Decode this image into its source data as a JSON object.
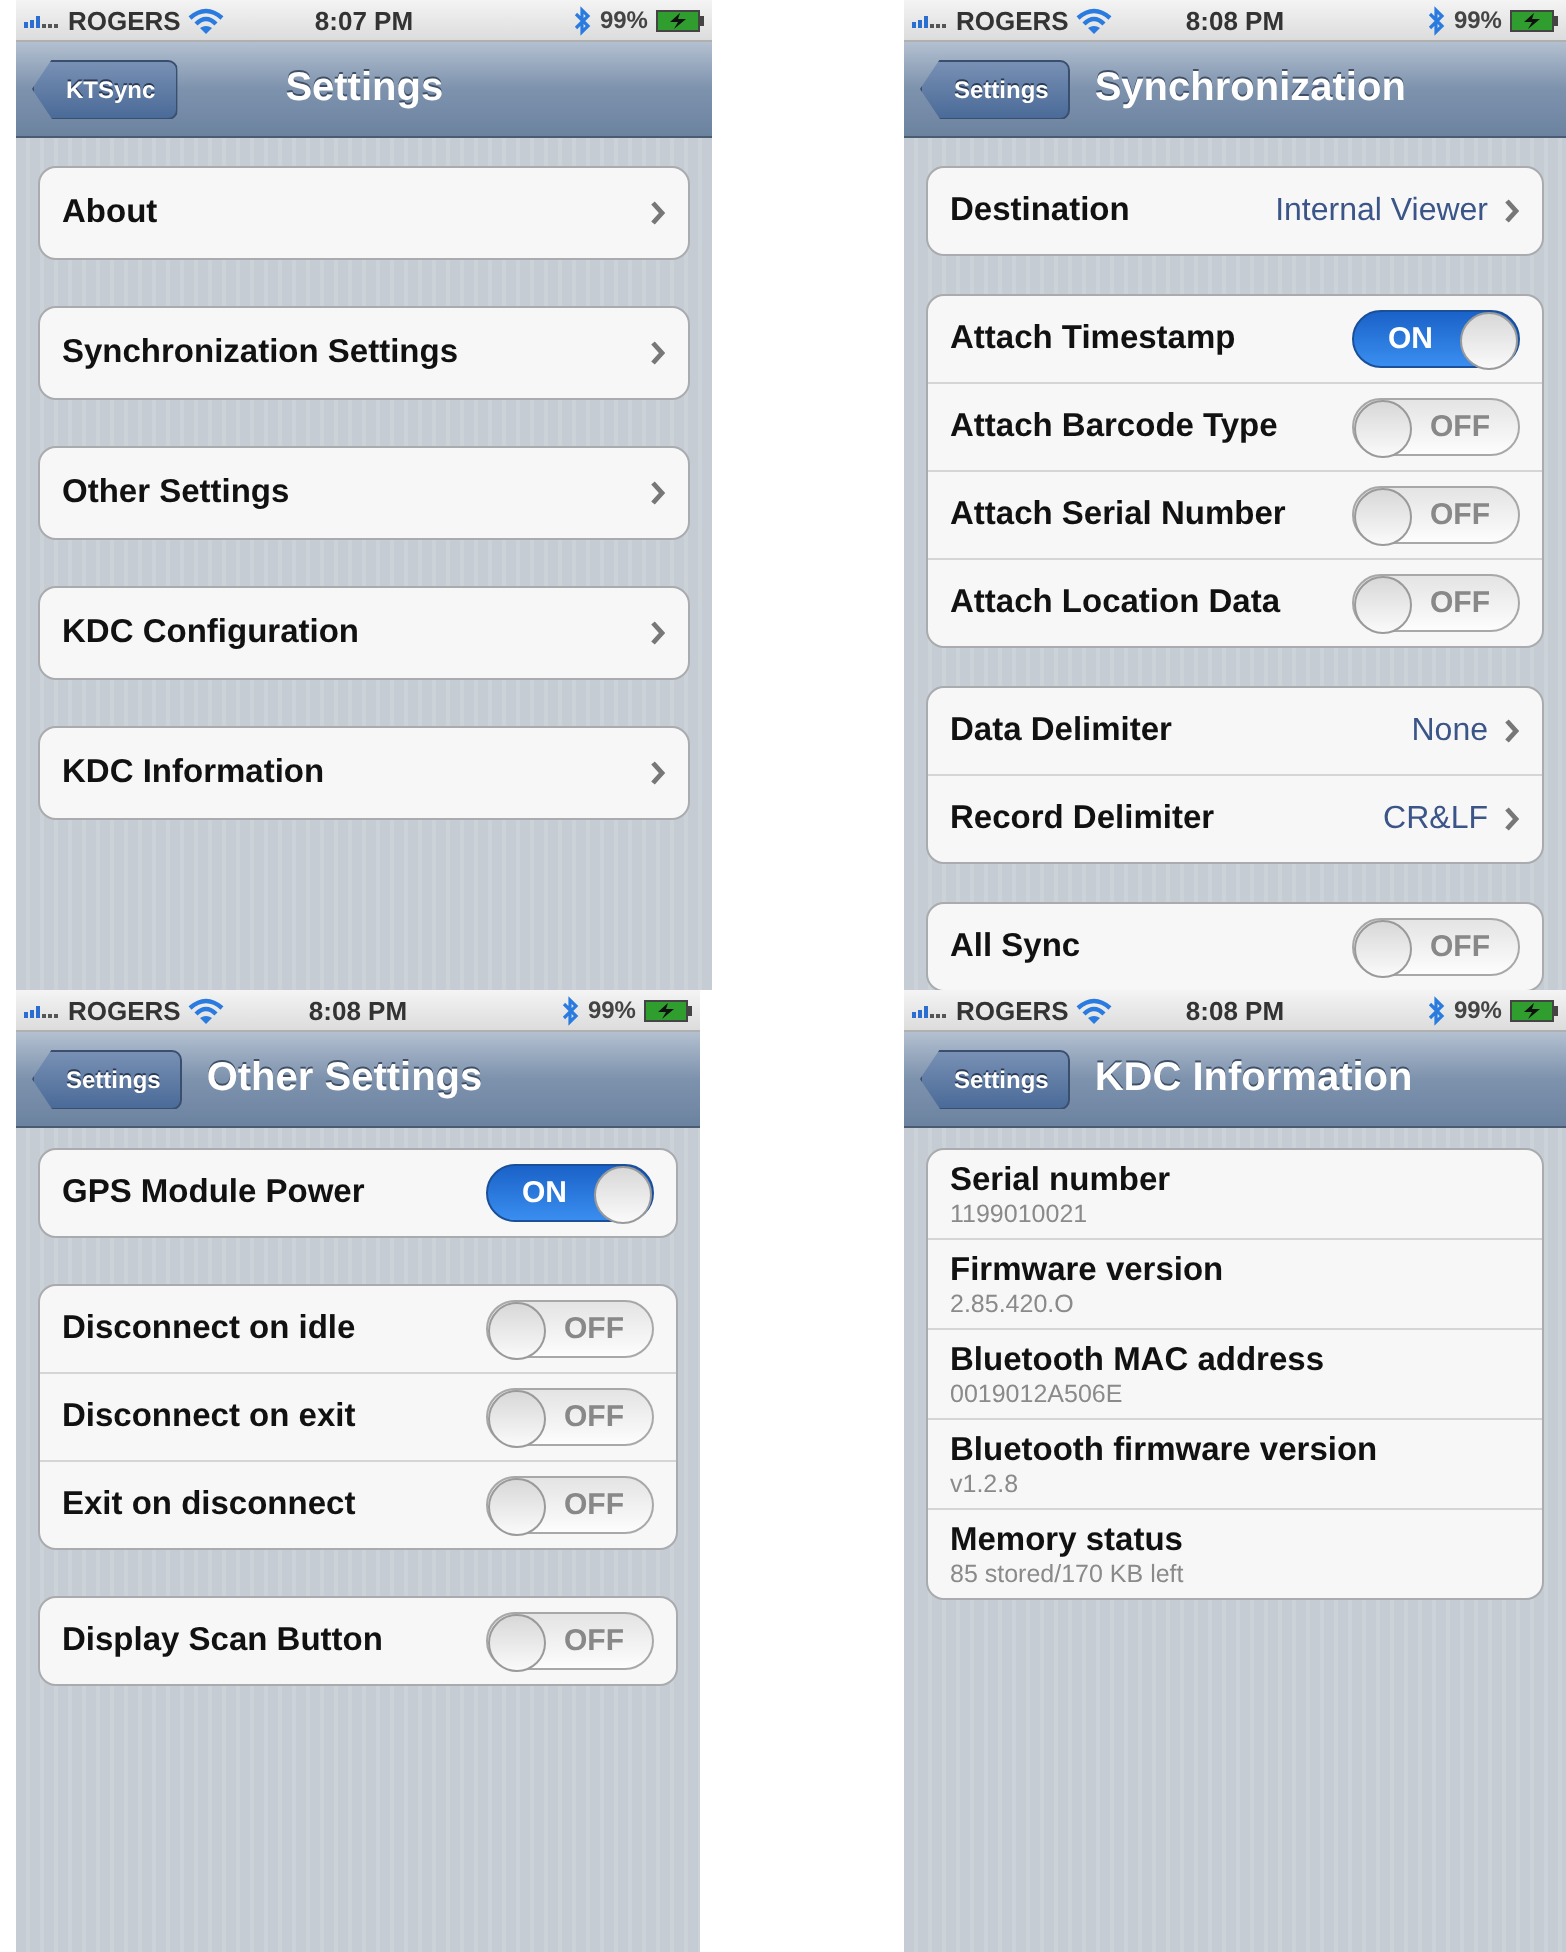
{
  "screens": [
    {
      "status_bar": {
        "carrier": "ROGERS",
        "time": "8:07 PM",
        "battery": "99%"
      },
      "nav_bar": {
        "back_button": "KTSync",
        "title": "Settings"
      },
      "groups": [
        {
          "rows": [
            {
              "kind": "disclosure",
              "label": "About"
            }
          ]
        },
        {
          "rows": [
            {
              "kind": "disclosure",
              "label": "Synchronization Settings"
            }
          ]
        },
        {
          "rows": [
            {
              "kind": "disclosure",
              "label": "Other Settings"
            }
          ]
        },
        {
          "rows": [
            {
              "kind": "disclosure",
              "label": "KDC Configuration"
            }
          ]
        },
        {
          "rows": [
            {
              "kind": "disclosure",
              "label": "KDC Information"
            }
          ]
        }
      ]
    },
    {
      "status_bar": {
        "carrier": "ROGERS",
        "time": "8:08 PM",
        "battery": "99%"
      },
      "nav_bar": {
        "back_button": "Settings",
        "title": "Synchronization"
      },
      "groups": [
        {
          "rows": [
            {
              "kind": "disclosure",
              "label": "Destination",
              "value": "Internal Viewer"
            }
          ]
        },
        {
          "rows": [
            {
              "kind": "toggle",
              "label": "Attach Timestamp",
              "on": true,
              "switch_text": "ON"
            },
            {
              "kind": "toggle",
              "label": "Attach Barcode Type",
              "on": false,
              "switch_text": "OFF"
            },
            {
              "kind": "toggle",
              "label": "Attach Serial Number",
              "on": false,
              "switch_text": "OFF"
            },
            {
              "kind": "toggle",
              "label": "Attach Location Data",
              "on": false,
              "switch_text": "OFF"
            }
          ]
        },
        {
          "rows": [
            {
              "kind": "disclosure",
              "label": "Data Delimiter",
              "value": "None"
            },
            {
              "kind": "disclosure",
              "label": "Record Delimiter",
              "value": "CR&LF"
            }
          ]
        },
        {
          "rows": [
            {
              "kind": "toggle",
              "label": "All Sync",
              "on": false,
              "switch_text": "OFF"
            }
          ]
        }
      ]
    },
    {
      "status_bar": {
        "carrier": "ROGERS",
        "time": "8:08 PM",
        "battery": "99%"
      },
      "nav_bar": {
        "back_button": "Settings",
        "title": "Other Settings"
      },
      "groups": [
        {
          "rows": [
            {
              "kind": "toggle",
              "label": "GPS Module Power",
              "on": true,
              "switch_text": "ON"
            }
          ]
        },
        {
          "rows": [
            {
              "kind": "toggle",
              "label": "Disconnect on idle",
              "on": false,
              "switch_text": "OFF"
            },
            {
              "kind": "toggle",
              "label": "Disconnect on exit",
              "on": false,
              "switch_text": "OFF"
            },
            {
              "kind": "toggle",
              "label": "Exit on disconnect",
              "on": false,
              "switch_text": "OFF"
            }
          ]
        },
        {
          "rows": [
            {
              "kind": "toggle",
              "label": "Display Scan Button",
              "on": false,
              "switch_text": "OFF"
            }
          ]
        }
      ]
    },
    {
      "status_bar": {
        "carrier": "ROGERS",
        "time": "8:08 PM",
        "battery": "99%"
      },
      "nav_bar": {
        "back_button": "Settings",
        "title": "KDC Information"
      },
      "groups": [
        {
          "rows": [
            {
              "kind": "info",
              "label": "Serial number",
              "detail": "1199010021"
            },
            {
              "kind": "info",
              "label": "Firmware version",
              "detail": "2.85.420.O"
            },
            {
              "kind": "info",
              "label": "Bluetooth MAC address",
              "detail": "0019012A506E"
            },
            {
              "kind": "info",
              "label": "Bluetooth firmware version",
              "detail": "v1.2.8"
            },
            {
              "kind": "info",
              "label": "Memory status",
              "detail": "85 stored/170 KB left"
            }
          ]
        }
      ]
    }
  ]
}
